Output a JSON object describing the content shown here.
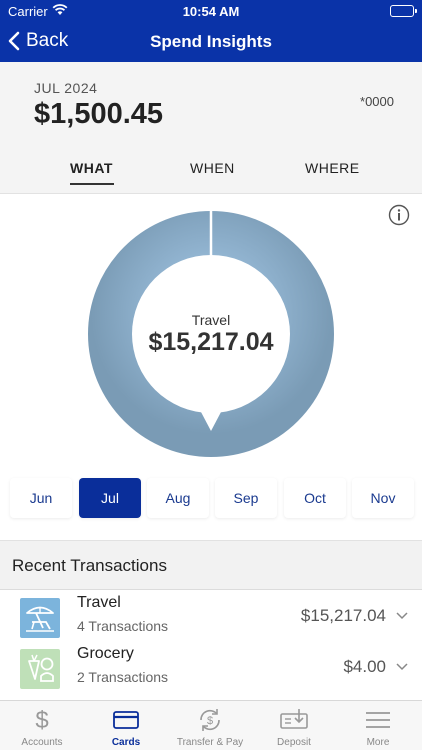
{
  "status_bar": {
    "carrier": "Carrier",
    "time": "10:54 AM"
  },
  "nav": {
    "back_label": "Back",
    "title": "Spend Insights"
  },
  "summary": {
    "period": "JUL 2024",
    "amount": "$1,500.45",
    "card": "*0000",
    "tabs": [
      "WHAT",
      "WHEN",
      "WHERE"
    ],
    "active_tab": "WHAT"
  },
  "chart_data": {
    "type": "pie",
    "categories": [
      "Travel"
    ],
    "values": [
      15217.04
    ],
    "center_label": "Travel",
    "center_value": "$15,217.04",
    "ring_color": "#8fb0cc"
  },
  "months": {
    "items": [
      "Jun",
      "Jul",
      "Aug",
      "Sep",
      "Oct",
      "Nov"
    ],
    "selected": "Jul"
  },
  "recent": {
    "heading": "Recent Transactions",
    "items": [
      {
        "name": "Travel",
        "count": "4 Transactions",
        "amount": "$15,217.04",
        "icon": "beach-chair-icon",
        "color": "#7cb4dc"
      },
      {
        "name": "Grocery",
        "count": "2 Transactions",
        "amount": "$4.00",
        "icon": "grocery-icon",
        "color": "#bfe0b8"
      }
    ]
  },
  "tab_bar": {
    "items": [
      {
        "label": "Accounts",
        "icon": "dollar-icon"
      },
      {
        "label": "Cards",
        "icon": "card-icon"
      },
      {
        "label": "Transfer & Pay",
        "icon": "transfer-icon"
      },
      {
        "label": "Deposit",
        "icon": "deposit-icon"
      },
      {
        "label": "More",
        "icon": "menu-icon"
      }
    ],
    "active": "Cards"
  },
  "colors": {
    "brand": "#0a33a8",
    "selected_month": "#0a2e9a"
  }
}
